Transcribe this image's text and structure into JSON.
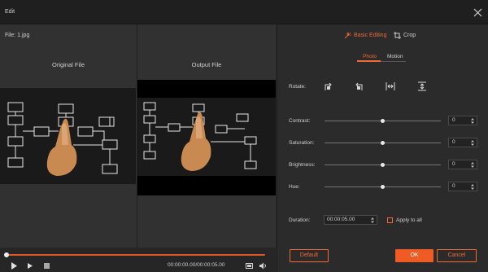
{
  "window": {
    "title": "Edit"
  },
  "preview": {
    "file_label": "File:  1.jpg",
    "original_title": "Original File",
    "output_title": "Output File"
  },
  "transport": {
    "timecode": "00:00:00.00/00:00:05.00",
    "progress_fraction": 0.0
  },
  "tabs": {
    "basic_editing": "Basic Editing",
    "crop": "Crop"
  },
  "subtabs": {
    "photo": "Photo",
    "motion": "Motion"
  },
  "rotate": {
    "label": "Rotate:"
  },
  "adjustments": {
    "contrast": {
      "label": "Contrast:",
      "value": "0",
      "fraction": 0.5
    },
    "saturation": {
      "label": "Saturation:",
      "value": "0",
      "fraction": 0.5
    },
    "brightness": {
      "label": "Brightness:",
      "value": "0",
      "fraction": 0.5
    },
    "hue": {
      "label": "Hue:",
      "value": "0",
      "fraction": 0.5
    }
  },
  "duration": {
    "label": "Duration:",
    "value": "00:00:05.00",
    "apply_all_label": "Apply to all"
  },
  "buttons": {
    "default": "Default",
    "ok": "OK",
    "cancel": "Cancel"
  },
  "colors": {
    "accent": "#ef5b24",
    "panel": "#2b2b2b",
    "titlebar": "#1f1f1f"
  }
}
